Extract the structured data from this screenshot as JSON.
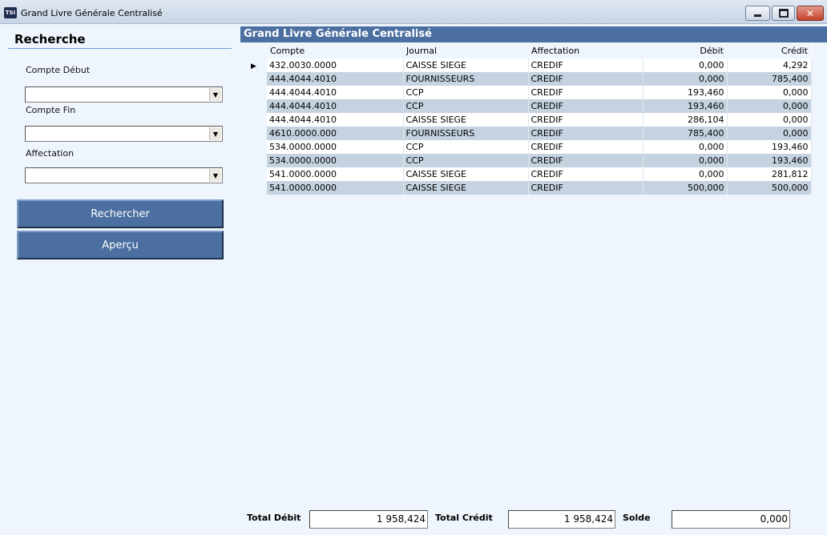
{
  "window": {
    "title": "Grand Livre Générale Centralisé",
    "app_icon_text": "TSI"
  },
  "search": {
    "title": "Recherche",
    "compte_debut_label": "Compte Début",
    "compte_debut_value": "",
    "compte_fin_label": "Compte Fin",
    "compte_fin_value": "",
    "affectation_label": "Affectation",
    "affectation_value": "",
    "rechercher_label": "Rechercher",
    "apercu_label": "Aperçu"
  },
  "grid": {
    "caption": "Grand Livre Générale Centralisé",
    "columns": [
      "Compte",
      "Journal",
      "Affectation",
      "Débit",
      "Crédit"
    ],
    "rows": [
      {
        "compte": "432.0030.0000",
        "journal": "CAISSE SIEGE",
        "affectation": "CREDIF",
        "debit": "0,000",
        "credit": "4,292"
      },
      {
        "compte": "444.4044.4010",
        "journal": "FOURNISSEURS",
        "affectation": "CREDIF",
        "debit": "0,000",
        "credit": "785,400"
      },
      {
        "compte": "444.4044.4010",
        "journal": "CCP",
        "affectation": "CREDIF",
        "debit": "193,460",
        "credit": "0,000"
      },
      {
        "compte": "444.4044.4010",
        "journal": "CCP",
        "affectation": "CREDIF",
        "debit": "193,460",
        "credit": "0,000"
      },
      {
        "compte": "444.4044.4010",
        "journal": "CAISSE SIEGE",
        "affectation": "CREDIF",
        "debit": "286,104",
        "credit": "0,000"
      },
      {
        "compte": "4610.0000.000",
        "journal": "FOURNISSEURS",
        "affectation": "CREDIF",
        "debit": "785,400",
        "credit": "0,000"
      },
      {
        "compte": "534.0000.0000",
        "journal": "CCP",
        "affectation": "CREDIF",
        "debit": "0,000",
        "credit": "193,460"
      },
      {
        "compte": "534.0000.0000",
        "journal": "CCP",
        "affectation": "CREDIF",
        "debit": "0,000",
        "credit": "193,460"
      },
      {
        "compte": "541.0000.0000",
        "journal": "CAISSE SIEGE",
        "affectation": "CREDIF",
        "debit": "0,000",
        "credit": "281,812"
      },
      {
        "compte": "541.0000.0000",
        "journal": "CAISSE SIEGE",
        "affectation": "CREDIF",
        "debit": "500,000",
        "credit": "500,000"
      }
    ]
  },
  "totals": {
    "total_debit_label": "Total Débit",
    "total_debit_value": "1 958,424",
    "total_credit_label": "Total Crédit",
    "total_credit_value": "1 958,424",
    "solde_label": "Solde",
    "solde_value": "0,000"
  },
  "colors": {
    "accent": "#4a6fa0",
    "background": "#eef5fc",
    "alt_row": "#c5d3e1"
  }
}
